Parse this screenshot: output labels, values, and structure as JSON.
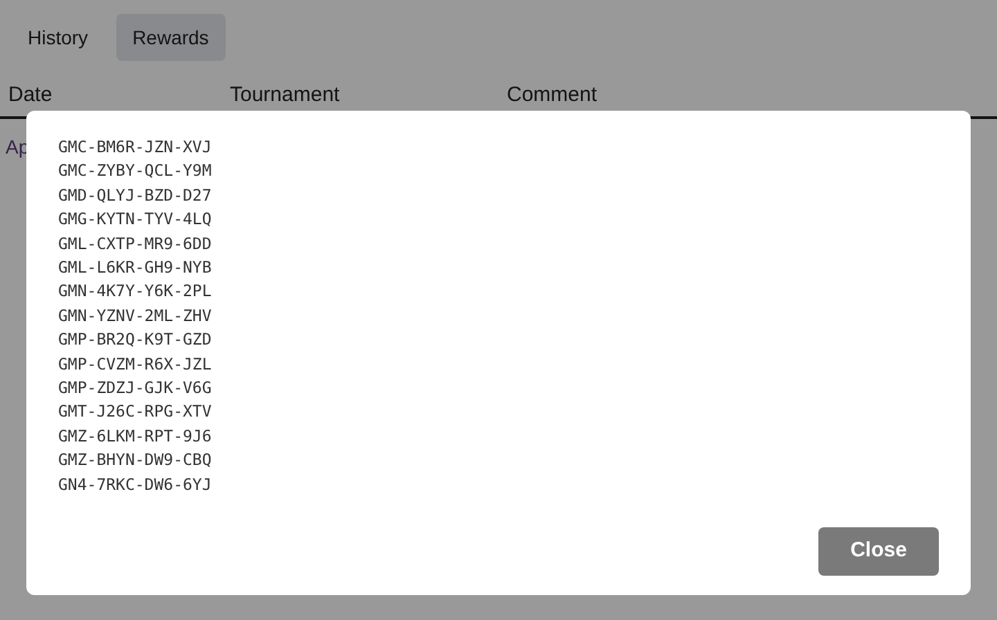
{
  "tabs": [
    {
      "label": "History",
      "selected": false
    },
    {
      "label": "Rewards",
      "selected": true
    }
  ],
  "table": {
    "columns": [
      "Date",
      "Tournament",
      "Comment"
    ],
    "rows": [
      [
        "Ap"
      ]
    ]
  },
  "dialog": {
    "codes": [
      "GMC-BM6R-JZN-XVJ",
      "GMC-ZYBY-QCL-Y9M",
      "GMD-QLYJ-BZD-D27",
      "GMG-KYTN-TYV-4LQ",
      "GML-CXTP-MR9-6DD",
      "GML-L6KR-GH9-NYB",
      "GMN-4K7Y-Y6K-2PL",
      "GMN-YZNV-2ML-ZHV",
      "GMP-BR2Q-K9T-GZD",
      "GMP-CVZM-R6X-JZL",
      "GMP-ZDZJ-GJK-V6G",
      "GMT-J26C-RPG-XTV",
      "GMZ-6LKM-RPT-9J6",
      "GMZ-BHYN-DW9-CBQ",
      "GN4-7RKC-DW6-6YJ"
    ],
    "buttons": [
      "Close"
    ]
  }
}
